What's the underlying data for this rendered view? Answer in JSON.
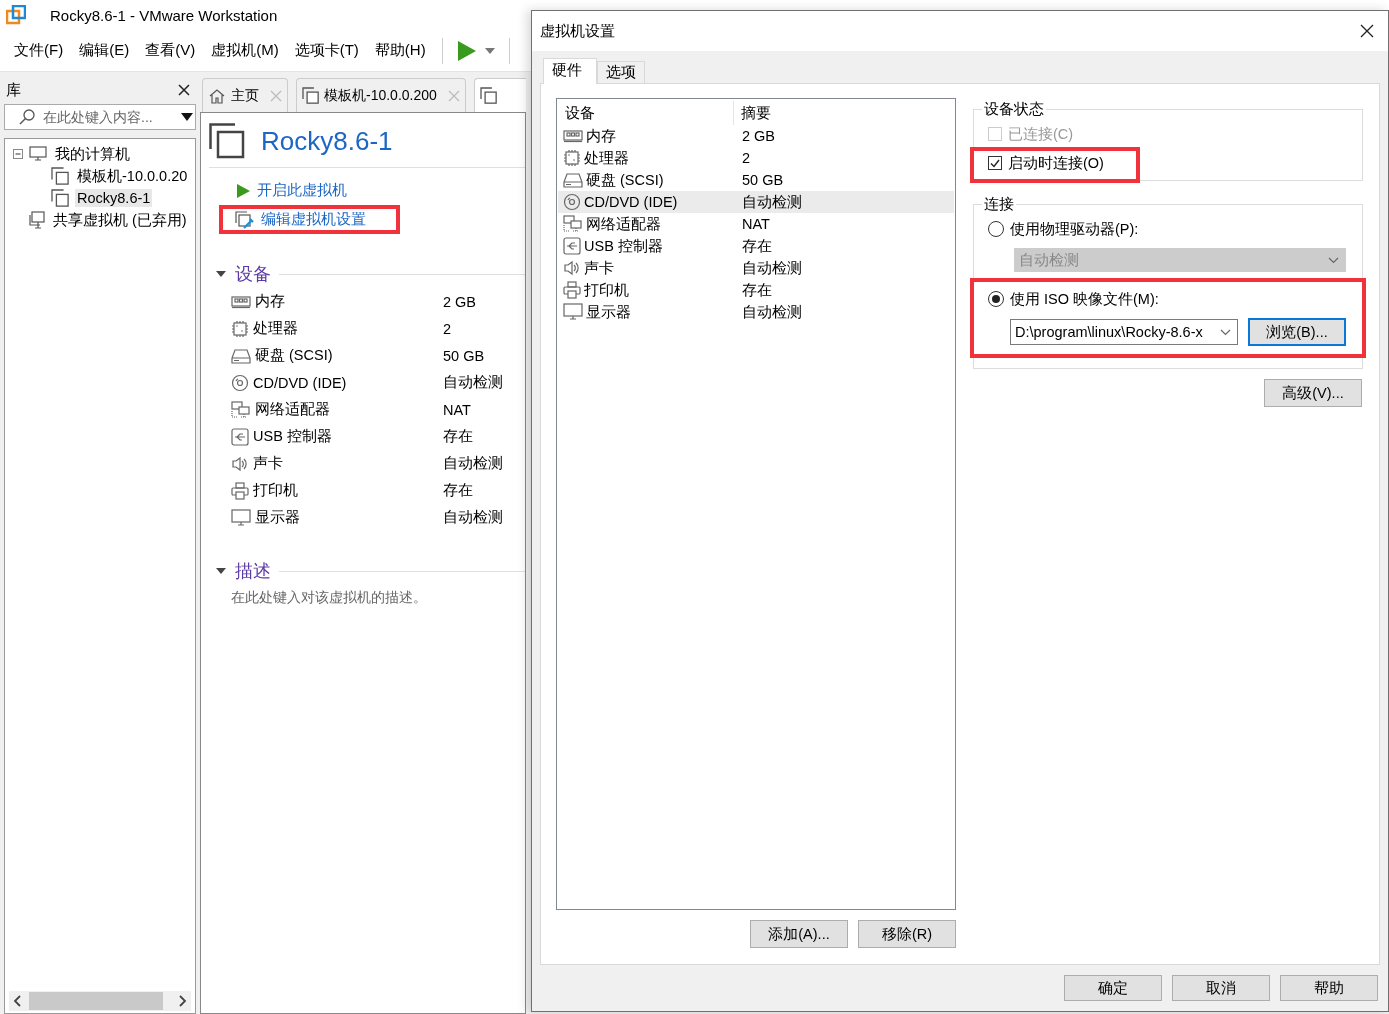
{
  "window": {
    "title": "Rocky8.6-1 - VMware Workstation"
  },
  "menu": [
    {
      "label": "文件(F)"
    },
    {
      "label": "编辑(E)"
    },
    {
      "label": "查看(V)"
    },
    {
      "label": "虚拟机(M)"
    },
    {
      "label": "选项卡(T)"
    },
    {
      "label": "帮助(H)"
    }
  ],
  "library": {
    "title": "库",
    "search": {
      "placeholder": "在此处键入内容..."
    },
    "tree": [
      {
        "label": "我的计算机",
        "kind": "computer",
        "selected": false,
        "expanded": true,
        "children": [
          {
            "label": "模板机-10.0.0.20",
            "kind": "vm",
            "selected": false
          },
          {
            "label": "Rocky8.6-1",
            "kind": "vm",
            "selected": true
          }
        ]
      },
      {
        "label": "共享虚拟机 (已弃用)",
        "kind": "shared",
        "selected": false
      }
    ]
  },
  "tabs": [
    {
      "label": "主页",
      "kind": "home",
      "selected": false
    },
    {
      "label": "模板机-10.0.0.200",
      "kind": "vm",
      "selected": false
    },
    {
      "kind": "vm",
      "selected": true
    }
  ],
  "vm": {
    "name": "Rocky8.6-1",
    "actions": [
      {
        "label": "开启此虚拟机",
        "kind": "power",
        "highlighted": false
      },
      {
        "label": "编辑虚拟机设置",
        "kind": "edit",
        "highlighted": true
      }
    ],
    "devices_title": "设备",
    "devices": [
      {
        "kind": "memory",
        "name": "内存",
        "summary": "2 GB"
      },
      {
        "kind": "cpu",
        "name": "处理器",
        "summary": "2"
      },
      {
        "kind": "disk",
        "name": "硬盘 (SCSI)",
        "summary": "50 GB"
      },
      {
        "kind": "disc",
        "name": "CD/DVD (IDE)",
        "summary": "自动检测"
      },
      {
        "kind": "network",
        "name": "网络适配器",
        "summary": "NAT"
      },
      {
        "kind": "usb",
        "name": "USB 控制器",
        "summary": "存在"
      },
      {
        "kind": "sound",
        "name": "声卡",
        "summary": "自动检测"
      },
      {
        "kind": "printer",
        "name": "打印机",
        "summary": "存在"
      },
      {
        "kind": "display",
        "name": "显示器",
        "summary": "自动检测"
      }
    ],
    "description_title": "描述",
    "description": {
      "placeholder": "在此处键入对该虚拟机的描述。"
    }
  },
  "dialog": {
    "title": "虚拟机设置",
    "tabs": [
      {
        "label": "硬件",
        "selected": true
      },
      {
        "label": "选项",
        "selected": false
      }
    ],
    "columns": [
      "设备",
      "摘要"
    ],
    "devices": [
      {
        "kind": "memory",
        "name": "内存",
        "summary": "2 GB",
        "selected": false
      },
      {
        "kind": "cpu",
        "name": "处理器",
        "summary": "2",
        "selected": false
      },
      {
        "kind": "disk",
        "name": "硬盘 (SCSI)",
        "summary": "50 GB",
        "selected": false
      },
      {
        "kind": "disc",
        "name": "CD/DVD (IDE)",
        "summary": "自动检测",
        "selected": true
      },
      {
        "kind": "network",
        "name": "网络适配器",
        "summary": "NAT",
        "selected": false
      },
      {
        "kind": "usb",
        "name": "USB 控制器",
        "summary": "存在",
        "selected": false
      },
      {
        "kind": "sound",
        "name": "声卡",
        "summary": "自动检测",
        "selected": false
      },
      {
        "kind": "printer",
        "name": "打印机",
        "summary": "存在",
        "selected": false
      },
      {
        "kind": "display",
        "name": "显示器",
        "summary": "自动检测",
        "selected": false
      }
    ],
    "list_buttons": [
      "添加(A)...",
      "移除(R)"
    ],
    "status": {
      "title": "设备状态",
      "options": [
        {
          "label": "已连接(C)",
          "checked": false,
          "disabled": true,
          "highlighted": false
        },
        {
          "label": "启动时连接(O)",
          "checked": true,
          "disabled": false,
          "highlighted": true
        }
      ]
    },
    "connection": {
      "title": "连接",
      "physical": {
        "label": "使用物理驱动器(P):",
        "selected": false,
        "drive": {
          "value": "自动检测",
          "disabled": true
        }
      },
      "iso": {
        "label": "使用 ISO 映像文件(M):",
        "selected": true,
        "highlighted": true,
        "path": "D:\\program\\linux\\Rocky-8.6-x",
        "browse": "浏览(B)..."
      }
    },
    "advanced": "高级(V)...",
    "buttons": [
      "确定",
      "取消",
      "帮助"
    ]
  }
}
